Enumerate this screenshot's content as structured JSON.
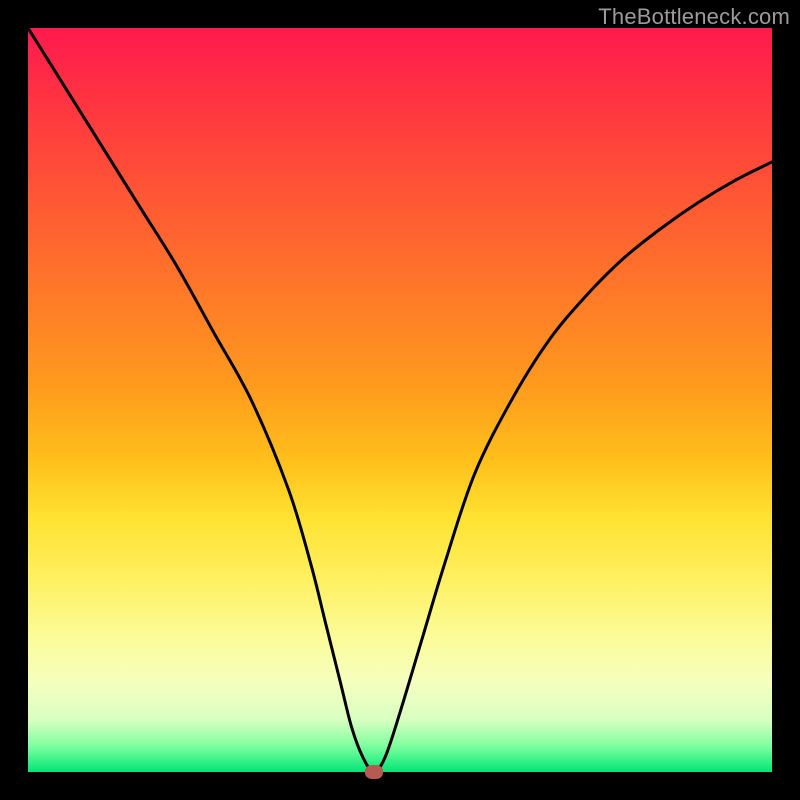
{
  "watermark": "TheBottleneck.com",
  "colors": {
    "frame_bg": "#000000",
    "marker": "#b65a52",
    "curve": "#000000",
    "watermark": "#9b9b9b"
  },
  "chart_data": {
    "type": "line",
    "title": "",
    "xlabel": "",
    "ylabel": "",
    "xlim": [
      0,
      100
    ],
    "ylim": [
      0,
      100
    ],
    "grid": false,
    "legend": false,
    "series": [
      {
        "name": "bottleneck-curve",
        "x": [
          0,
          5,
          10,
          15,
          20,
          25,
          30,
          35,
          38,
          40,
          42,
          43.5,
          45,
          46.5,
          48,
          50,
          53,
          56,
          60,
          65,
          70,
          75,
          80,
          85,
          90,
          95,
          100
        ],
        "y": [
          100,
          92,
          84,
          76,
          68,
          59,
          50,
          38,
          28,
          20,
          12,
          6,
          2,
          0,
          2,
          8,
          18,
          28,
          40,
          50,
          58,
          64,
          69,
          73,
          76.5,
          79.5,
          82
        ]
      }
    ],
    "marker": {
      "x": 46.5,
      "y": 0
    },
    "background_gradient": [
      {
        "stop": 0.0,
        "color": "#ff1a4d"
      },
      {
        "stop": 0.48,
        "color": "#ff9a1e"
      },
      {
        "stop": 0.74,
        "color": "#fff060"
      },
      {
        "stop": 0.93,
        "color": "#d8ffc0"
      },
      {
        "stop": 1.0,
        "color": "#00e676"
      }
    ]
  }
}
